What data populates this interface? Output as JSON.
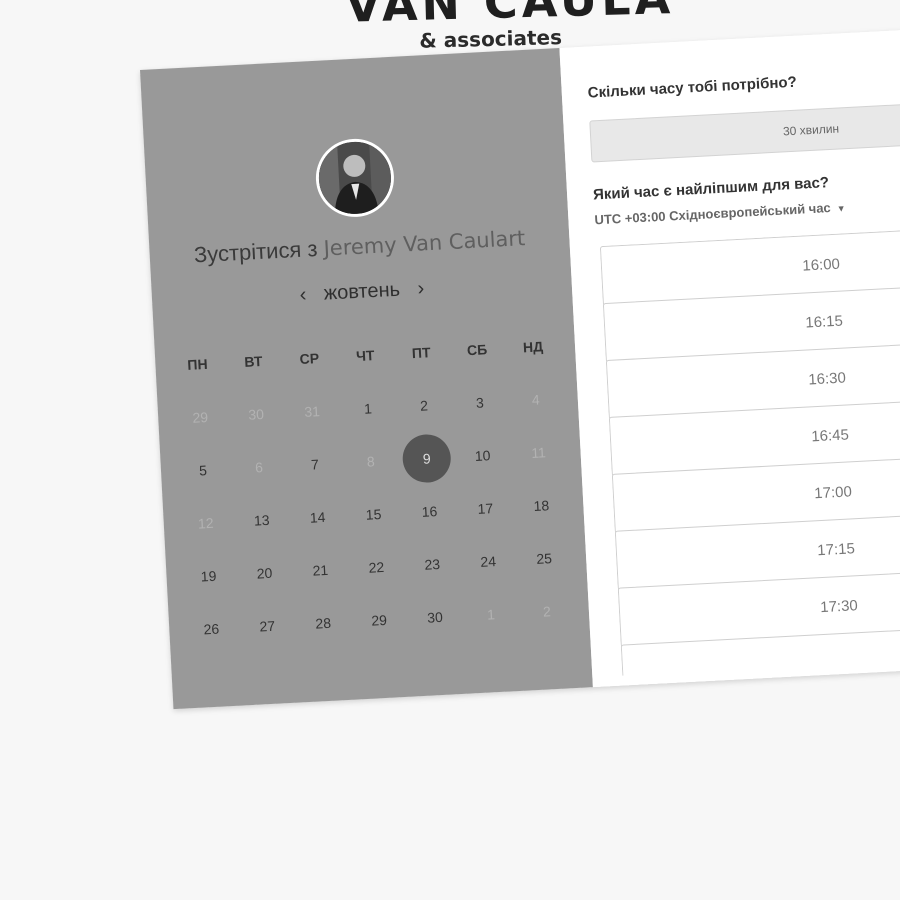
{
  "brand": {
    "name": "VAN CAULA",
    "sub": "& associates"
  },
  "left": {
    "meet_prefix": "Зустрітися з",
    "host": "Jeremy Van Caulart",
    "month": "жовтень",
    "prev": "‹",
    "next": "›",
    "weekdays": [
      "ПН",
      "ВТ",
      "СР",
      "ЧТ",
      "ПТ",
      "СБ",
      "НД"
    ],
    "weeks": [
      [
        {
          "d": "29",
          "m": true
        },
        {
          "d": "30",
          "m": true
        },
        {
          "d": "31",
          "m": true
        },
        {
          "d": "1"
        },
        {
          "d": "2"
        },
        {
          "d": "3"
        },
        {
          "d": "4",
          "m": true
        }
      ],
      [
        {
          "d": "5"
        },
        {
          "d": "6",
          "m": true
        },
        {
          "d": "7"
        },
        {
          "d": "8",
          "m": true
        },
        {
          "d": "9",
          "s": true
        },
        {
          "d": "10"
        },
        {
          "d": "11",
          "m": true
        }
      ],
      [
        {
          "d": "12",
          "m": true
        },
        {
          "d": "13"
        },
        {
          "d": "14"
        },
        {
          "d": "15"
        },
        {
          "d": "16"
        },
        {
          "d": "17"
        },
        {
          "d": "18"
        }
      ],
      [
        {
          "d": "19"
        },
        {
          "d": "20"
        },
        {
          "d": "21"
        },
        {
          "d": "22"
        },
        {
          "d": "23"
        },
        {
          "d": "24"
        },
        {
          "d": "25"
        }
      ],
      [
        {
          "d": "26"
        },
        {
          "d": "27"
        },
        {
          "d": "28"
        },
        {
          "d": "29"
        },
        {
          "d": "30"
        },
        {
          "d": "1",
          "m": true
        },
        {
          "d": "2",
          "m": true
        }
      ]
    ]
  },
  "right": {
    "q1": "Скільки часу тобі потрібно?",
    "duration": "30 хвилин",
    "q2": "Який час є найліпшим для вас?",
    "timezone": "UTC +03:00 Східноєвропейський час",
    "slots": [
      "16:00",
      "16:15",
      "16:30",
      "16:45",
      "17:00",
      "17:15",
      "17:30",
      ""
    ]
  }
}
